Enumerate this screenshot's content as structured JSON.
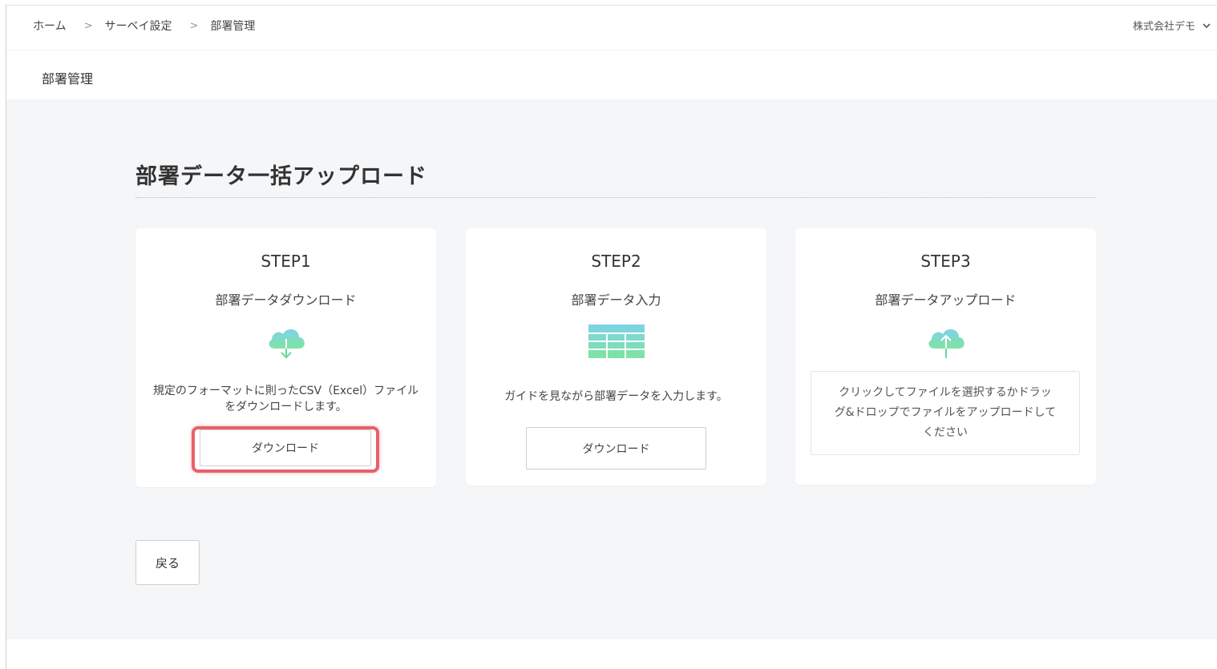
{
  "breadcrumb": {
    "items": [
      "ホーム",
      "サーベイ設定",
      "部署管理"
    ],
    "separator": ">"
  },
  "header": {
    "company": "株式会社デモ",
    "company_icon": "chevron-down-icon"
  },
  "subheader": {
    "title": "部署管理"
  },
  "main": {
    "heading": "部署データ一括アップロード",
    "steps": [
      {
        "step": "STEP1",
        "title": "部署データダウンロード",
        "icon": "cloud-download-icon",
        "description": "規定のフォーマットに則ったCSV（Excel）ファイルをダウンロードします。",
        "button_label": "ダウンロード"
      },
      {
        "step": "STEP2",
        "title": "部署データ入力",
        "icon": "table-icon",
        "description": "ガイドを見ながら部署データを入力します。",
        "button_label": "ダウンロード"
      },
      {
        "step": "STEP3",
        "title": "部署データアップロード",
        "icon": "cloud-upload-icon",
        "dropzone_text": "クリックしてファイルを選択するかドラッグ&ドロップでファイルをアップロードしてください"
      }
    ],
    "back_label": "戻る"
  },
  "colors": {
    "highlight": "#e8606a",
    "icon_gradient_top": "#7dd3e8",
    "icon_gradient_bottom": "#7fe3a0",
    "background": "#f5f6f8"
  }
}
